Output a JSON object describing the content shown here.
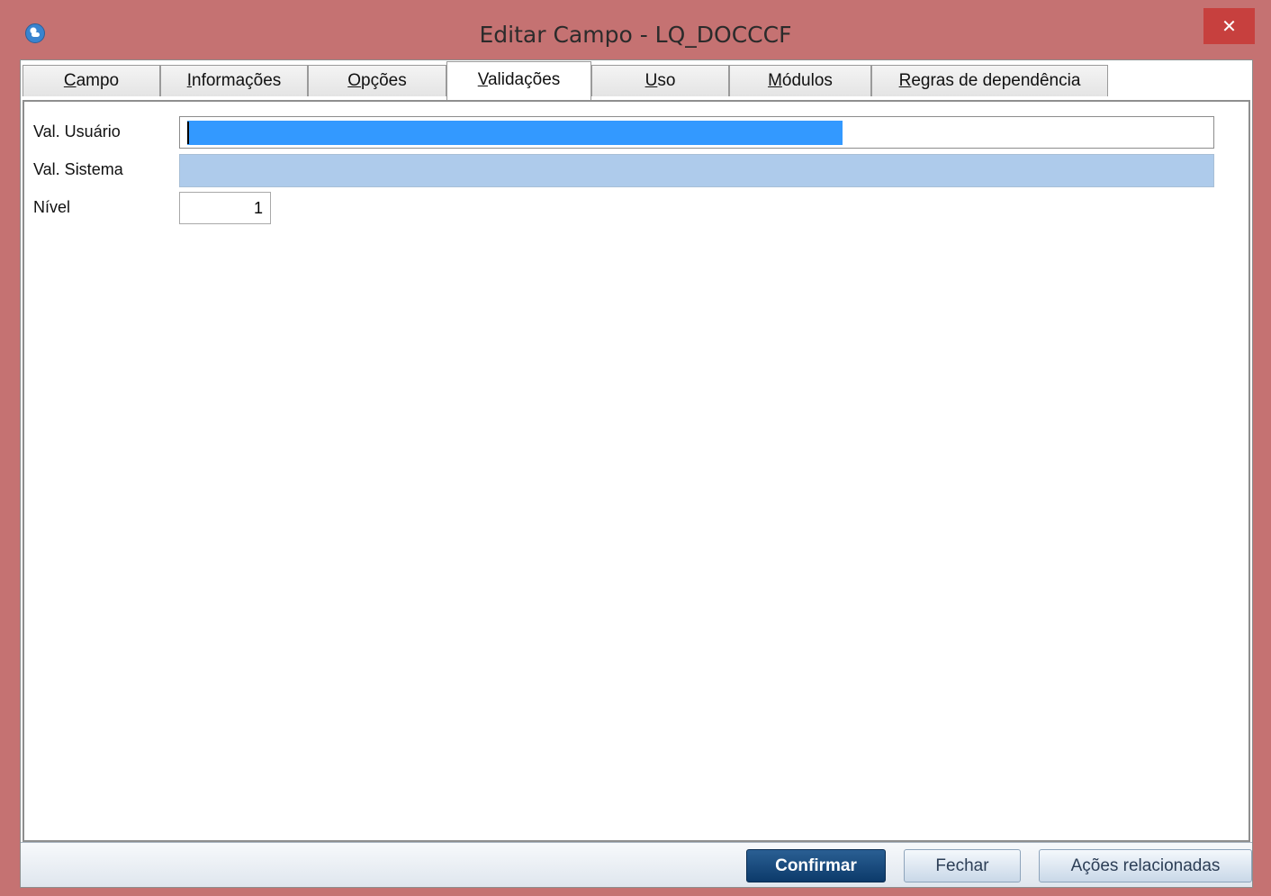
{
  "window": {
    "title": "Editar Campo - LQ_DOCCCF",
    "close_glyph": "✕",
    "app_icon": "protheus-globe-icon",
    "frame_color": "#c57272"
  },
  "tabs": [
    {
      "label": "Campo",
      "mnemonic": "C",
      "rest": "ampo",
      "active": false
    },
    {
      "label": "Informações",
      "mnemonic": "I",
      "rest": "nformações",
      "active": false
    },
    {
      "label": "Opções",
      "mnemonic": "O",
      "rest": "pções",
      "active": false
    },
    {
      "label": "Validações",
      "mnemonic": "V",
      "rest": "alidações",
      "active": true
    },
    {
      "label": "Uso",
      "mnemonic": "U",
      "rest": "so",
      "active": false
    },
    {
      "label": "Módulos",
      "mnemonic": "M",
      "rest": "ódulos",
      "active": false
    },
    {
      "label": "Regras de dependência",
      "mnemonic": "R",
      "rest": "egras de dependência",
      "active": false
    }
  ],
  "form": {
    "user_validation": {
      "label": "Val. Usuário",
      "value": ""
    },
    "system_validation": {
      "label": "Val. Sistema",
      "value": ""
    },
    "level": {
      "label": "Nível",
      "value": "1"
    }
  },
  "footer": {
    "confirm_label": "Confirmar",
    "close_label": "Fechar",
    "actions_label": "Ações relacionadas"
  },
  "colors": {
    "selection": "#3399ff",
    "readonly_field": "#aecbeb",
    "primary_button": "#0c3a6a"
  }
}
